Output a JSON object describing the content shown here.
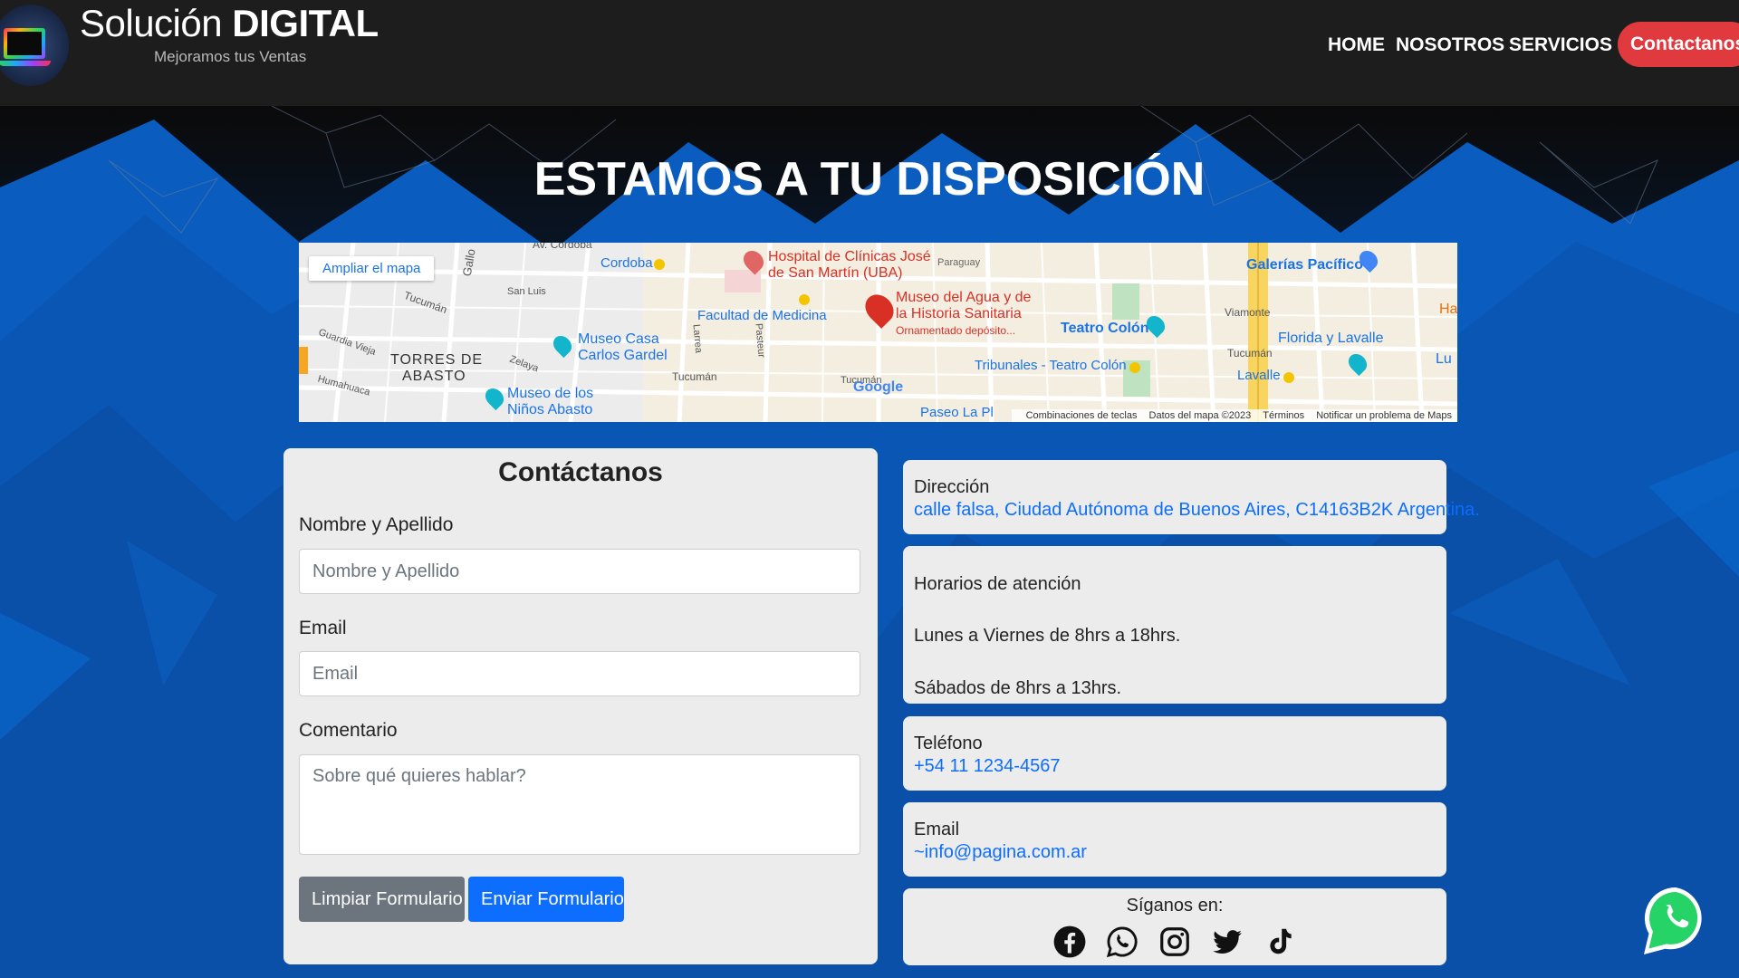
{
  "header": {
    "brand_light": "Solución",
    "brand_bold": "DIGITAL",
    "tagline": "Mejoramos tus Ventas",
    "nav": [
      {
        "label": "HOME"
      },
      {
        "label": "NOSOTROS"
      },
      {
        "label": "SERVICIOS"
      },
      {
        "label": "Contactanos"
      }
    ],
    "cta_color": "#e03a3e"
  },
  "hero": {
    "title": "ESTAMOS A TU DISPOSICIÓN"
  },
  "map": {
    "enlarge_button": "Ampliar el mapa",
    "labels": {
      "av_cordoba": "Av. Córdoba",
      "gallo": "Gallo",
      "cordoba": "Cordoba",
      "hospital_1": "Hospital de Clínicas José",
      "hospital_2": "de San Martín (UBA)",
      "paraguay": "Paraguay",
      "galerias": "Galerías Pacífico",
      "tucuman_1": "Tucumán",
      "san_luis": "San Luis",
      "facultad": "Facultad de Medicina",
      "museo_agua_1": "Museo del Agua y de",
      "museo_agua_2": "la Historia Sanitaria",
      "museo_agua_3": "Ornamentado depósito...",
      "teatro_colon": "Teatro Colón",
      "viamonte": "Viamonte",
      "ha": "Ha",
      "florida": "Florida y Lavalle",
      "guardia_vieja": "Guardia Vieja",
      "torres_1": "TORRES DE",
      "torres_2": "ABASTO",
      "museo_gardel_1": "Museo Casa",
      "museo_gardel_2": "Carlos Gardel",
      "zelaya": "Zelaya",
      "larrea": "Larrea",
      "pasteur": "Pasteur",
      "tucuman_2": "Tucumán",
      "tribunales": "Tribunales - Teatro Colón",
      "tucuman_3": "Tucumán",
      "lavalle": "Lavalle",
      "lu": "Lu",
      "humahuaca": "Humahuaca",
      "museo_ninos_1": "Museo de los",
      "museo_ninos_2": "Niños Abasto",
      "tucuman_4": "Tucumán",
      "paseo": "Paseo La Pl",
      "google": "Google"
    },
    "footer": {
      "shortcuts": "Combinaciones de teclas",
      "data": "Datos del mapa ©2023",
      "terms": "Términos",
      "report": "Notificar un problema de Maps"
    }
  },
  "form": {
    "title": "Contáctanos",
    "name_label": "Nombre y Apellido",
    "name_placeholder": "Nombre y Apellido",
    "email_label": "Email",
    "email_placeholder": "Email",
    "comment_label": "Comentario",
    "comment_placeholder": "Sobre qué quieres hablar?",
    "clear_button": "Limpiar Formulario",
    "send_button": "Enviar Formulario"
  },
  "info": {
    "address_label": "Dirección",
    "address_value": "calle falsa, Ciudad Autónoma de Buenos Aires, C14163B2K Argentina.",
    "hours_label": "Horarios de atención",
    "hours_weekdays": "Lunes a Viernes de 8hrs a 18hrs.",
    "hours_saturday": "Sábados de 8hrs a 13hrs.",
    "phone_label": "Teléfono",
    "phone_value": "+54 11 1234-4567",
    "email_label": "Email",
    "email_value": "~info@pagina.com.ar",
    "social_title": "Síganos en:",
    "social_icons": [
      "facebook-icon",
      "whatsapp-icon",
      "instagram-icon",
      "twitter-icon",
      "tiktok-icon"
    ]
  },
  "colors": {
    "navbar": "#1d1d1d",
    "hero_blue": "#0a4fa8",
    "card_bg": "#ececec",
    "link_blue": "#0d6efd",
    "whatsapp_green": "#25d366"
  }
}
